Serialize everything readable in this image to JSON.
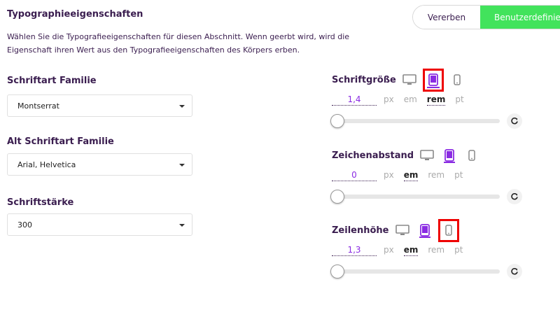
{
  "section": {
    "title": "Typographieeigenschaften",
    "description": "Wählen Sie die Typografieeigenschaften für diesen Abschnitt. Wenn geerbt wird, wird die Eigenschaft ihren Wert aus den Typografieeigenschaften des Körpers erben.",
    "inherit_label": "Vererben",
    "custom_label": "Benutzerdefiniert",
    "active_mode": "Benutzerdefiniert"
  },
  "fields": {
    "font_family": {
      "label": "Schriftart Familie",
      "value": "Montserrat"
    },
    "alt_font_family": {
      "label": "Alt Schriftart Familie",
      "value": "Arial, Helvetica"
    },
    "font_weight": {
      "label": "Schriftstärke",
      "value": "300"
    }
  },
  "units": [
    "px",
    "em",
    "rem",
    "pt"
  ],
  "properties": {
    "font_size": {
      "label": "Schriftgröße",
      "value": "1,4",
      "active_unit": "rem",
      "active_device": "tablet"
    },
    "letter_spacing": {
      "label": "Zeichenabstand",
      "value": "0",
      "active_unit": "em",
      "active_device": "tablet"
    },
    "line_height": {
      "label": "Zeilenhöhe",
      "value": "1,3",
      "active_unit": "em",
      "active_device": "tablet"
    }
  },
  "colors": {
    "accent": "#8a2be2",
    "toggle_active": "#42e35c",
    "highlight": "#ee0000",
    "text": "#3a1d4f"
  },
  "icons": {
    "desktop": "desktop-icon",
    "tablet": "tablet-icon",
    "mobile": "mobile-icon",
    "reset": "reset-icon",
    "caret": "chevron-down-icon"
  }
}
